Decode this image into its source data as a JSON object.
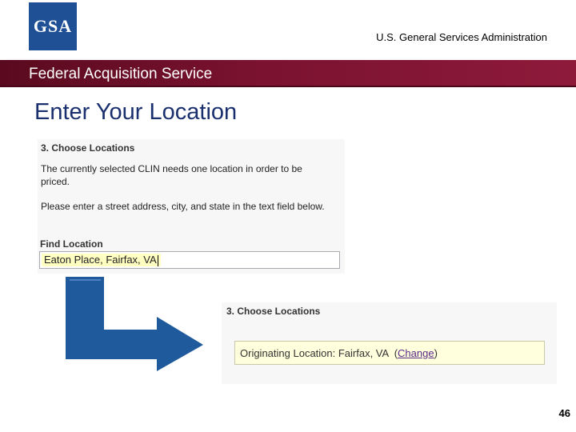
{
  "header": {
    "logo_text": "GSA",
    "agency": "U.S. General Services Administration",
    "banner": "Federal Acquisition Service"
  },
  "slide": {
    "title": "Enter Your Location",
    "page_number": "46"
  },
  "step_before": {
    "heading": "3. Choose Locations",
    "paragraph_1": "The currently selected CLIN needs one location in order to be priced.",
    "paragraph_2": "Please enter a street address, city, and state in the text field below.",
    "find_label": "Find Location",
    "location_value": "Eaton Place, Fairfax, VA"
  },
  "step_after": {
    "heading": "3. Choose Locations",
    "origin_label": "Originating Location: Fairfax, VA",
    "paren_open": "(",
    "change_link": "Change",
    "paren_close": ")"
  },
  "colors": {
    "banner": "#7a1230",
    "logo": "#1f4f95",
    "arrow": "#1f5a9c",
    "title": "#1a2f6e"
  },
  "icons": {
    "arrow": "elbow-arrow-icon"
  }
}
